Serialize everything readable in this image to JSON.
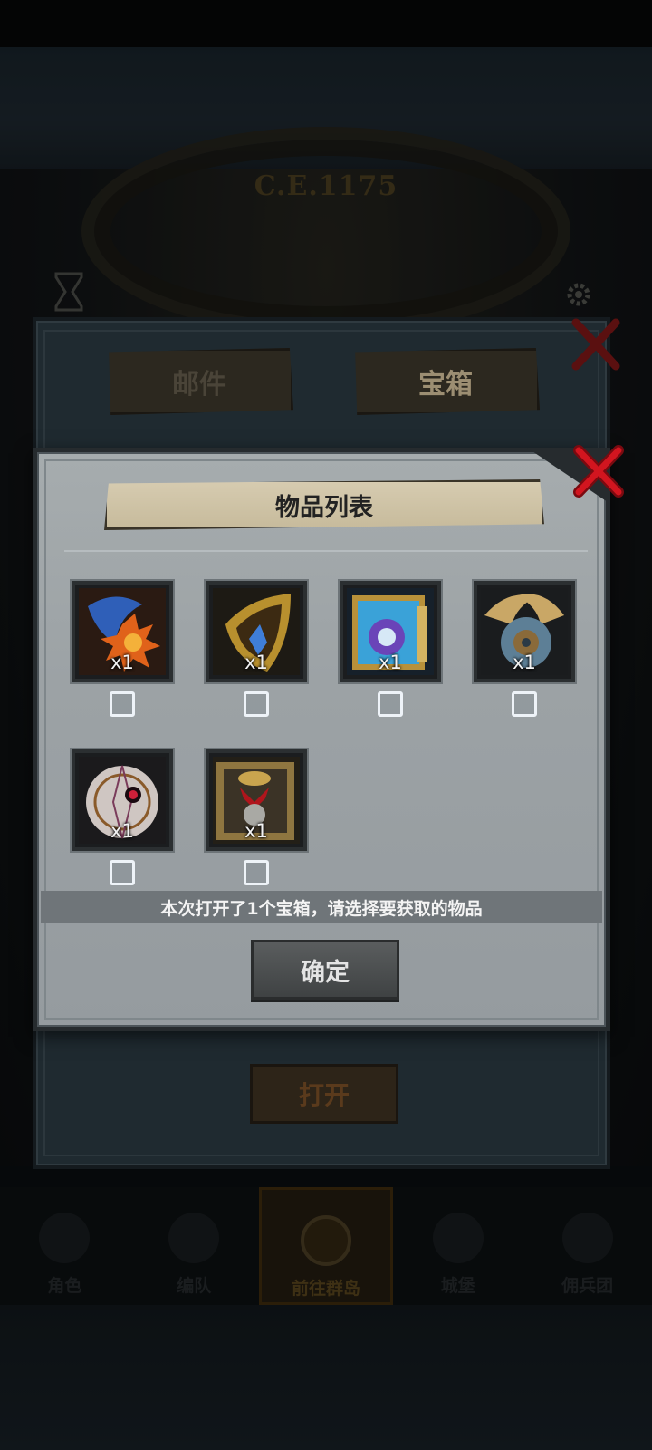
{
  "background": {
    "era_label": "C.E.1175",
    "nav": [
      {
        "label": "角色"
      },
      {
        "label": "编队"
      },
      {
        "label": "前往群岛"
      },
      {
        "label": "城堡"
      },
      {
        "label": "佣兵团"
      }
    ]
  },
  "mailbox_panel": {
    "tabs": [
      {
        "label": "邮件"
      },
      {
        "label": "宝箱"
      }
    ],
    "open_button_label": "打开"
  },
  "dialog": {
    "title": "物品列表",
    "items": [
      {
        "icon": "fire-ice-claw-icon",
        "quantity": "x1",
        "selected": false
      },
      {
        "icon": "golden-shield-icon",
        "quantity": "x1",
        "selected": false
      },
      {
        "icon": "blue-spellbook-icon",
        "quantity": "x1",
        "selected": false
      },
      {
        "icon": "winged-shield-icon",
        "quantity": "x1",
        "selected": false
      },
      {
        "icon": "eye-orb-icon",
        "quantity": "x1",
        "selected": false
      },
      {
        "icon": "skull-armor-icon",
        "quantity": "x1",
        "selected": false
      }
    ],
    "message": "本次打开了1个宝箱，请选择要获取的物品",
    "confirm_label": "确定"
  },
  "colors": {
    "dialog_bg": "#9ca2a5",
    "scroll_bg": "#d2c6a9",
    "close_red": "#c8101a",
    "checkbox_border": "#eef3f8"
  }
}
